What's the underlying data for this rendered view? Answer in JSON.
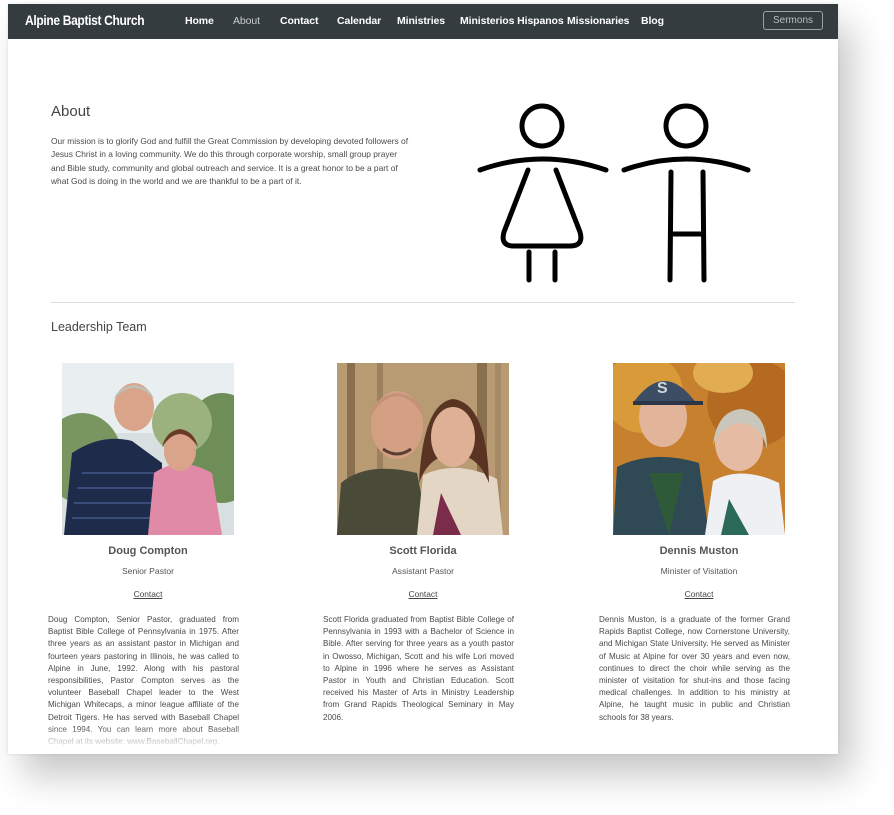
{
  "nav": {
    "brand": "Alpine Baptist Church",
    "items": [
      "Home",
      "About",
      "Contact",
      "Calendar",
      "Ministries",
      "Ministerios Hispanos",
      "Missionaries",
      "Blog"
    ],
    "sermons_label": "Sermons"
  },
  "about": {
    "title": "About",
    "text": "Our mission is to glorify God and fulfill the Great Commission by developing devoted followers of Jesus Christ in a loving community. We do this through corporate worship, small group prayer and Bible study, community and global outreach and service. It is a great honor to be a part of what God is doing in the world and we are thankful to be a part of it."
  },
  "leadership": {
    "title": "Leadership Team",
    "contact_label": "Contact",
    "leaders": [
      {
        "name": "Doug Compton",
        "role": "Senior Pastor",
        "bio": "Doug Compton, Senior Pastor, graduated from Baptist Bible College of Pennsylvania in 1975. After three years as an assistant pastor in Michigan and fourteen years pastoring in Illinois, he was called to Alpine in June, 1992. Along with his pastoral responsibilities, Pastor Compton serves as the volunteer Baseball Chapel leader to the West Michigan Whitecaps, a minor league affiliate of the Detroit Tigers. He has served with Baseball Chapel since 1994. You can learn more about Baseball Chapel at its website: www.BaseballChapel.org."
      },
      {
        "name": "Scott Florida",
        "role": "Assistant Pastor",
        "bio": "Scott Florida graduated from Baptist Bible College of Pennsylvania in 1993 with a Bachelor of Science in Bible. After serving for three years as a youth pastor in Owosso, Michigan, Scott and his wife Lori moved to Alpine in 1996 where he serves as Assistant Pastor in Youth and Christian Education. Scott received his Master of Arts in Ministry Leadership from Grand Rapids Theological Seminary in May 2006."
      },
      {
        "name": "Dennis Muston",
        "role": "Minister of Visitation",
        "bio": "Dennis Muston, is a graduate of the former Grand Rapids Baptist College, now Cornerstone University, and Michigan State University. He served as Minister of Music at Alpine for over 30 years and even now, continues to direct the choir while serving as the minister of visitation for shut-ins and those facing medical challenges. In addition to his ministry at Alpine, he taught music in public and Christian schools for 38 years."
      }
    ]
  },
  "colors": {
    "navbar": "#343c40",
    "text": "#444444",
    "divider": "#dcdcdc"
  }
}
